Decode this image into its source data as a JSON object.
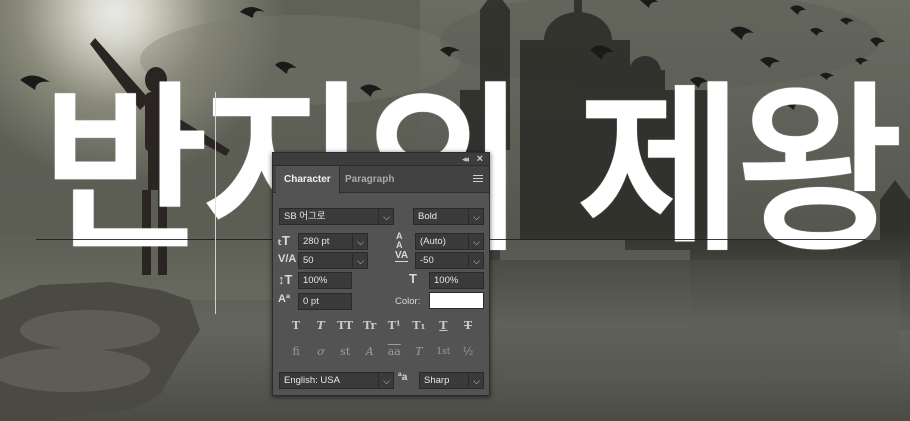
{
  "canvas": {
    "headline": "반지의 제왕"
  },
  "panel": {
    "tabs": [
      "Character",
      "Paragraph"
    ],
    "font_family": "SB 어그로",
    "font_style": "Bold",
    "font_size": "280 pt",
    "leading": "(Auto)",
    "kerning": "50",
    "tracking": "-50",
    "vertical_scale": "100%",
    "horizontal_scale": "100%",
    "baseline_shift": "0 pt",
    "color_label": "Color:",
    "color_value": "#ffffff",
    "language": "English: USA",
    "antialias_label": "ªa",
    "antialias": "Sharp",
    "style_buttons": [
      "T",
      "T",
      "TT",
      "Tr",
      "T¹",
      "T₁",
      "T",
      "T"
    ],
    "opentype_buttons": [
      "fi",
      "ơ",
      "st",
      "A",
      "aa",
      "T",
      "1st",
      "½"
    ],
    "icons": {
      "size": "size-icon",
      "leading": "leading-icon",
      "kerning": "kerning-icon",
      "tracking": "tracking-icon",
      "vscale": "vertical-scale-icon",
      "hscale": "horizontal-scale-icon",
      "baseline": "baseline-shift-icon"
    }
  }
}
